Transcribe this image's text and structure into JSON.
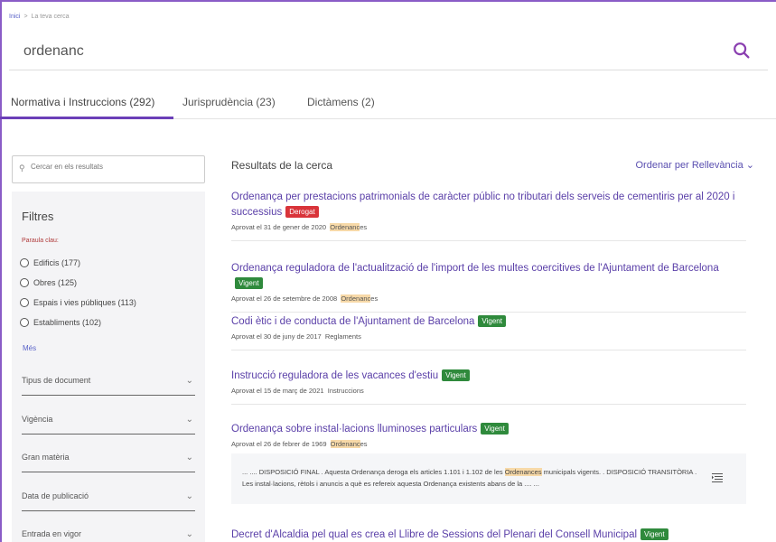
{
  "breadcrumb": {
    "home": "Inici",
    "separator": ">",
    "current": "La teva cerca"
  },
  "search": {
    "query": "ordenanc"
  },
  "tabs": [
    {
      "label": "Normativa i Instruccions (292)",
      "active": true
    },
    {
      "label": "Jurisprudència (23)",
      "active": false
    },
    {
      "label": "Dictàmens (2)",
      "active": false
    }
  ],
  "sidebar": {
    "search_placeholder": "Cercar en els resultats",
    "filters_title": "Filtres",
    "keyword_label": "Paraula clau:",
    "keywords": [
      "Edificis (177)",
      "Obres (125)",
      "Espais i vies públiques (113)",
      "Establiments (102)"
    ],
    "more_label": "Més",
    "facets": [
      "Tipus de document",
      "Vigència",
      "Gran matèria",
      "Data de publicació",
      "Entrada en vigor"
    ]
  },
  "results": {
    "heading": "Resultats de la cerca",
    "sort_label": "Ordenar per Rellevància",
    "items": [
      {
        "title": "Ordenança per prestacions patrimonials de caràcter públic no tributari dels serveis de cementiris per al 2020 i successius",
        "badge": "Derogat",
        "badge_color": "#d9343a",
        "meta_date": "Aprovat el 31 de gener de 2020",
        "meta_type_hl": "Ordenanc",
        "meta_type_rest": "es"
      },
      {
        "title": "Ordenança reguladora de l'actualització de l'import de les multes coercitives de l'Ajuntament de Barcelona",
        "badge": "Vigent",
        "badge_color": "#2f8a3c",
        "meta_date": "Aprovat el 26 de setembre de 2008",
        "meta_type_hl": "Ordenanc",
        "meta_type_rest": "es"
      },
      {
        "title": "Codi ètic i de conducta de l'Ajuntament de Barcelona",
        "badge": "Vigent",
        "badge_color": "#2f8a3c",
        "meta_date": "Aprovat el 30 de juny de 2017",
        "meta_type_hl": "",
        "meta_type_rest": "Reglaments"
      },
      {
        "title": "Instrucció reguladora de les vacances d'estiu",
        "badge": "Vigent",
        "badge_color": "#2f8a3c",
        "meta_date": "Aprovat el 15 de març de 2021",
        "meta_type_hl": "",
        "meta_type_rest": "Instruccions"
      },
      {
        "title": "Ordenança sobre instal·lacions lluminoses particulars",
        "badge": "Vigent",
        "badge_color": "#2f8a3c",
        "meta_date": "Aprovat el 26 de febrer de 1969",
        "meta_type_hl": "Ordenanc",
        "meta_type_rest": "es"
      },
      {
        "title": "Decret d'Alcaldia pel qual es crea el Llibre de Sessions del Plenari del Consell Municipal",
        "badge": "Vigent",
        "badge_color": "#2f8a3c",
        "meta_date": "",
        "meta_type_hl": "",
        "meta_type_rest": ""
      }
    ],
    "snippet": {
      "before": "... .... DISPOSICIÓ FINAL . Aquesta Ordenança deroga els articles 1.101 i 1.102 de les ",
      "highlight": "Ordenances",
      "after": " municipals vigents. . DISPOSICIÓ TRANSITÒRIA . Les instal·lacions, rètols i anuncis a què es refereix aquesta Ordenança existents abans de la .... ..."
    }
  },
  "colors": {
    "accent": "#6b3fb8",
    "link": "#5a3fa8",
    "derogat": "#d9343a",
    "vigent": "#2f8a3c",
    "highlight": "#f7d9a8"
  }
}
